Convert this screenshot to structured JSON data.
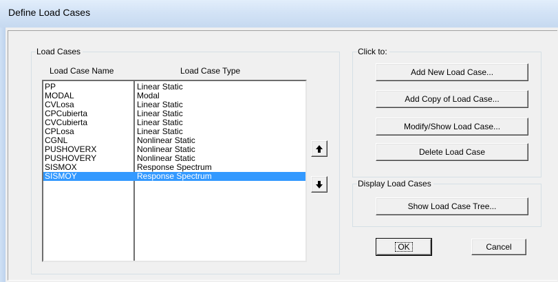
{
  "window": {
    "title": "Define Load Cases"
  },
  "load_cases_group": {
    "legend": "Load Cases",
    "headers": {
      "name": "Load Case Name",
      "type": "Load Case Type"
    },
    "rows": [
      {
        "name": "PP",
        "type": "Linear Static"
      },
      {
        "name": "MODAL",
        "type": "Modal"
      },
      {
        "name": "CVLosa",
        "type": "Linear Static"
      },
      {
        "name": "CPCubierta",
        "type": "Linear Static"
      },
      {
        "name": "CVCubierta",
        "type": "Linear Static"
      },
      {
        "name": "CPLosa",
        "type": "Linear Static"
      },
      {
        "name": "CGNL",
        "type": "Nonlinear Static"
      },
      {
        "name": "PUSHOVERX",
        "type": "Nonlinear Static"
      },
      {
        "name": "PUSHOVERY",
        "type": "Nonlinear Static"
      },
      {
        "name": "SISMOX",
        "type": "Response Spectrum"
      },
      {
        "name": "SISMOY",
        "type": "Response Spectrum"
      }
    ],
    "selected_index": 10,
    "move_up_icon": "arrow-up-icon",
    "move_down_icon": "arrow-down-icon"
  },
  "click_to_group": {
    "legend": "Click to:",
    "buttons": {
      "add_new": "Add New Load Case...",
      "add_copy": "Add Copy of Load Case...",
      "modify_show": "Modify/Show Load Case...",
      "delete": "Delete Load Case"
    }
  },
  "display_group": {
    "legend": "Display Load Cases",
    "show_tree": "Show Load Case Tree..."
  },
  "dialog_buttons": {
    "ok": "OK",
    "cancel": "Cancel"
  },
  "colors": {
    "selection": "#3399ff",
    "titlebar": "#d3e3f6",
    "face": "#f0f0f0"
  }
}
